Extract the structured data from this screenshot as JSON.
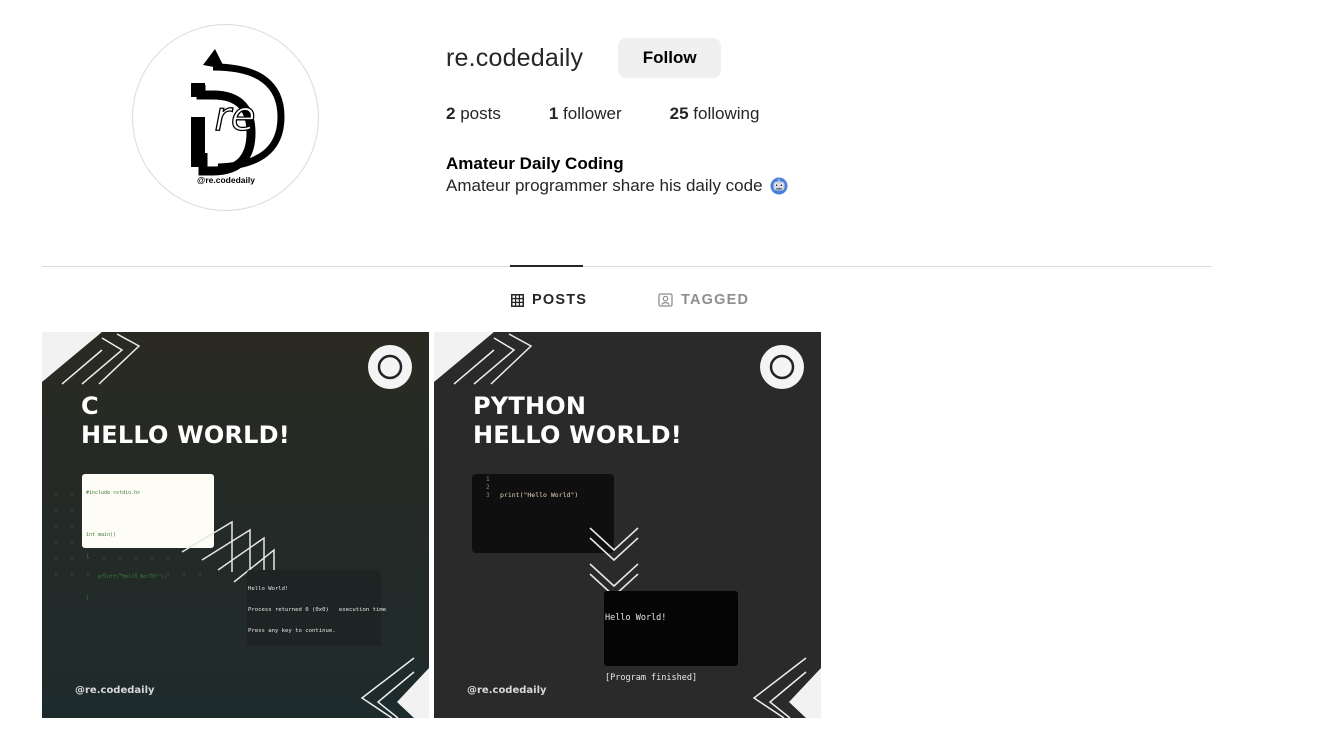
{
  "profile": {
    "username": "re.codedaily",
    "follow_label": "Follow",
    "avatar_handle": "@re.codedaily",
    "avatar_logo_text": "re"
  },
  "stats": {
    "posts_count": "2",
    "posts_label": "posts",
    "followers_count": "1",
    "followers_label": "follower",
    "following_count": "25",
    "following_label": "following"
  },
  "bio": {
    "name": "Amateur Daily Coding",
    "text": "Amateur programmer share his daily code",
    "emoji_icon": "robot-face-icon"
  },
  "tabs": [
    {
      "label": "POSTS",
      "icon": "grid-icon",
      "active": true
    },
    {
      "label": "TAGGED",
      "icon": "tagged-user-icon",
      "active": false
    }
  ],
  "posts": [
    {
      "title_line1": "C",
      "title_line2": "HELLO WORLD!",
      "handle": "@re.codedaily",
      "code_lines": [
        "#include <stdio.h>",
        "",
        "int main()",
        "{",
        "    printf(\"Hello World!\");",
        "}"
      ],
      "terminal_lines": [
        "Hello World!",
        "Process returned 0 (0x0)   execution time",
        "Press any key to continue."
      ]
    },
    {
      "title_line1": "PYTHON",
      "title_line2": "HELLO WORLD!",
      "handle": "@re.codedaily",
      "code_gutter": "1\n2\n3",
      "code_line": "print(\"Hello World\")",
      "terminal_lines": [
        "Hello World!",
        "",
        "[Program finished]"
      ]
    }
  ],
  "colors": {
    "follow_bg": "#efefef",
    "divider": "#dbdbdb",
    "tab_inactive": "#8e8e8e",
    "post_bg_dark": "#2a2a2a",
    "post_c_top": "#2a2a22",
    "post_c_bottom": "#1f2a2a"
  }
}
